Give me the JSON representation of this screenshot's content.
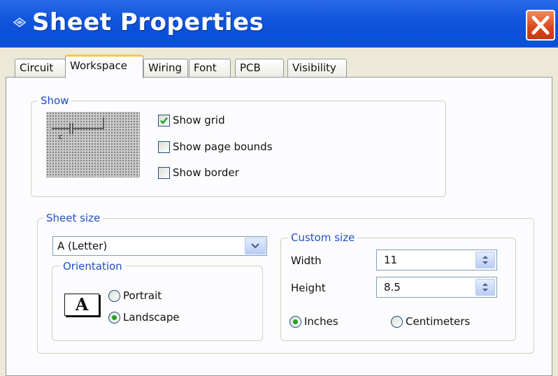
{
  "window": {
    "title": "Sheet Properties"
  },
  "tabs": [
    {
      "label": "Circuit",
      "active": false
    },
    {
      "label": "Workspace",
      "active": true
    },
    {
      "label": "Wiring",
      "active": false
    },
    {
      "label": "Font",
      "active": false
    },
    {
      "label": "PCB",
      "active": false
    },
    {
      "label": "Visibility",
      "active": false
    }
  ],
  "show": {
    "legend": "Show",
    "options": [
      {
        "label": "Show grid",
        "checked": true
      },
      {
        "label": "Show page bounds",
        "checked": false
      },
      {
        "label": "Show border",
        "checked": false
      }
    ]
  },
  "sheet_size": {
    "legend": "Sheet size",
    "selected": "A (Letter)",
    "orientation": {
      "legend": "Orientation",
      "icon_letter": "A",
      "options": [
        {
          "label": "Portrait",
          "selected": false
        },
        {
          "label": "Landscape",
          "selected": true
        }
      ]
    },
    "custom_size": {
      "legend": "Custom size",
      "width_label": "Width",
      "width_value": "11",
      "height_label": "Height",
      "height_value": "8.5",
      "units": [
        {
          "label": "Inches",
          "selected": true
        },
        {
          "label": "Centimeters",
          "selected": false
        }
      ]
    }
  },
  "colors": {
    "title_bar": "#0a4fd8",
    "legend_text": "#1f4fc2",
    "close_button": "#d9461c",
    "active_tab_accent": "#ffc83c",
    "radio_dot": "#21a121"
  }
}
